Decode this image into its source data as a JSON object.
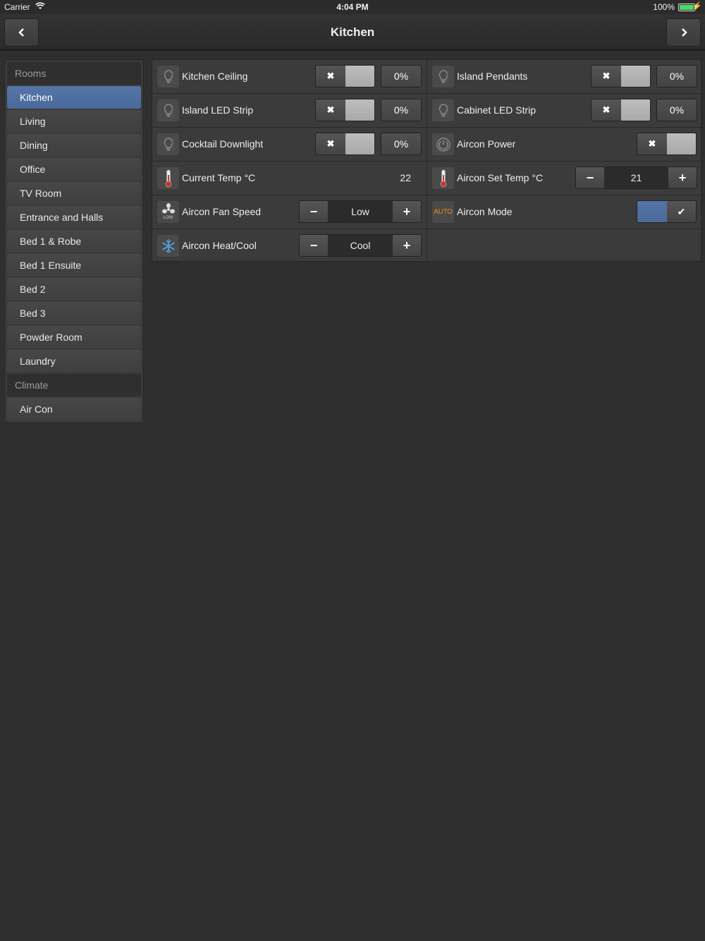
{
  "status": {
    "carrier": "Carrier",
    "time": "4:04 PM",
    "battery": "100%"
  },
  "nav": {
    "title": "Kitchen",
    "prev_icon": "chevron-left",
    "next_icon": "chevron-right"
  },
  "sidebar": {
    "rooms_header": "Rooms",
    "rooms": [
      {
        "label": "Kitchen",
        "active": true
      },
      {
        "label": "Living"
      },
      {
        "label": "Dining"
      },
      {
        "label": "Office"
      },
      {
        "label": "TV Room"
      },
      {
        "label": "Entrance and Halls"
      },
      {
        "label": "Bed 1 & Robe"
      },
      {
        "label": "Bed 1 Ensuite"
      },
      {
        "label": "Bed 2"
      },
      {
        "label": "Bed 3"
      },
      {
        "label": "Powder Room"
      },
      {
        "label": "Laundry"
      }
    ],
    "climate_header": "Climate",
    "climate": [
      {
        "label": "Air Con"
      }
    ]
  },
  "controls": {
    "kitchen_ceiling": {
      "label": "Kitchen Ceiling",
      "level": "0%",
      "toggle_icon": "x",
      "icon": "bulb-icon"
    },
    "island_pendants": {
      "label": "Island Pendants",
      "level": "0%",
      "toggle_icon": "x",
      "icon": "bulb-icon"
    },
    "island_led_strip": {
      "label": "Island LED Strip",
      "level": "0%",
      "toggle_icon": "x",
      "icon": "bulb-icon"
    },
    "cabinet_led_strip": {
      "label": "Cabinet LED Strip",
      "level": "0%",
      "toggle_icon": "x",
      "icon": "bulb-icon"
    },
    "cocktail_downlight": {
      "label": "Cocktail Downlight",
      "level": "0%",
      "toggle_icon": "x",
      "icon": "bulb-icon"
    },
    "aircon_power": {
      "label": "Aircon Power",
      "toggle_icon": "x",
      "icon": "power-icon"
    },
    "current_temp": {
      "label": "Current Temp °C",
      "value": "22",
      "icon": "thermometer-icon"
    },
    "aircon_set_temp": {
      "label": "Aircon Set Temp °C",
      "value": "21",
      "minus": "−",
      "plus": "+",
      "icon": "thermometer-icon"
    },
    "aircon_fan_speed": {
      "label": "Aircon Fan Speed",
      "value": "Low",
      "minus": "−",
      "plus": "+",
      "icon": "fan-icon",
      "icon_caption": "LOW"
    },
    "aircon_mode": {
      "label": "Aircon Mode",
      "icon_text": "AUTO",
      "checked": true
    },
    "aircon_heat_cool": {
      "label": "Aircon Heat/Cool",
      "value": "Cool",
      "minus": "−",
      "plus": "+",
      "icon": "snowflake-icon"
    }
  },
  "colors": {
    "accent": "#4a6a9b",
    "background": "#2f2f2f",
    "auto_orange": "#e08a1e",
    "thermo_red": "#d0312d",
    "snow_blue": "#4fa3e0"
  }
}
